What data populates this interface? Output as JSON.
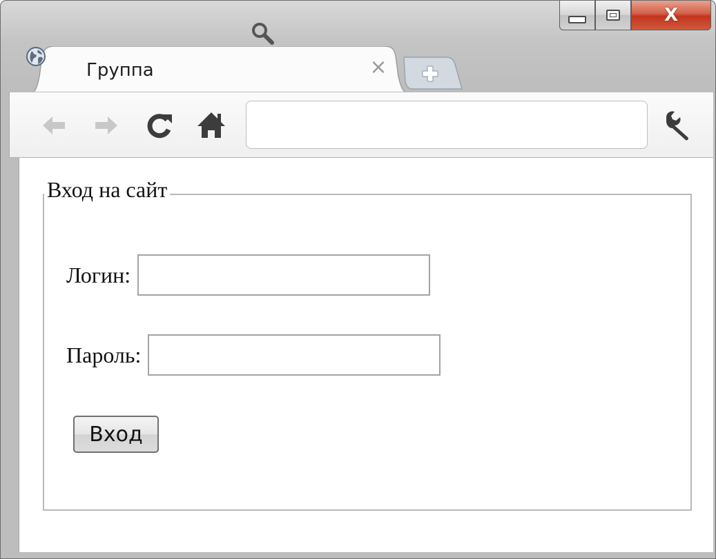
{
  "browser": {
    "tab": {
      "title": "Группа",
      "close_glyph": "×",
      "favicon": "globe-icon"
    },
    "new_tab_icon": "plus-icon",
    "window_controls": {
      "close_glyph": "X"
    },
    "toolbar": {
      "icons": [
        "back-arrow-icon",
        "forward-arrow-icon",
        "reload-icon",
        "home-icon",
        "wrench-icon"
      ],
      "omnibox": {
        "value": "",
        "icon": "search-icon"
      }
    },
    "colors": {
      "close_button": "#c9432a",
      "chrome_frame": "#c4c4c4",
      "disabled_arrow": "#c8c8c8",
      "toolbar_icon": "#3c3c3c"
    }
  },
  "form": {
    "legend": "Вход на сайт",
    "login_label": "Логин:",
    "login_value": "",
    "password_label": "Пароль:",
    "password_value": "",
    "submit_label": "Вход"
  }
}
